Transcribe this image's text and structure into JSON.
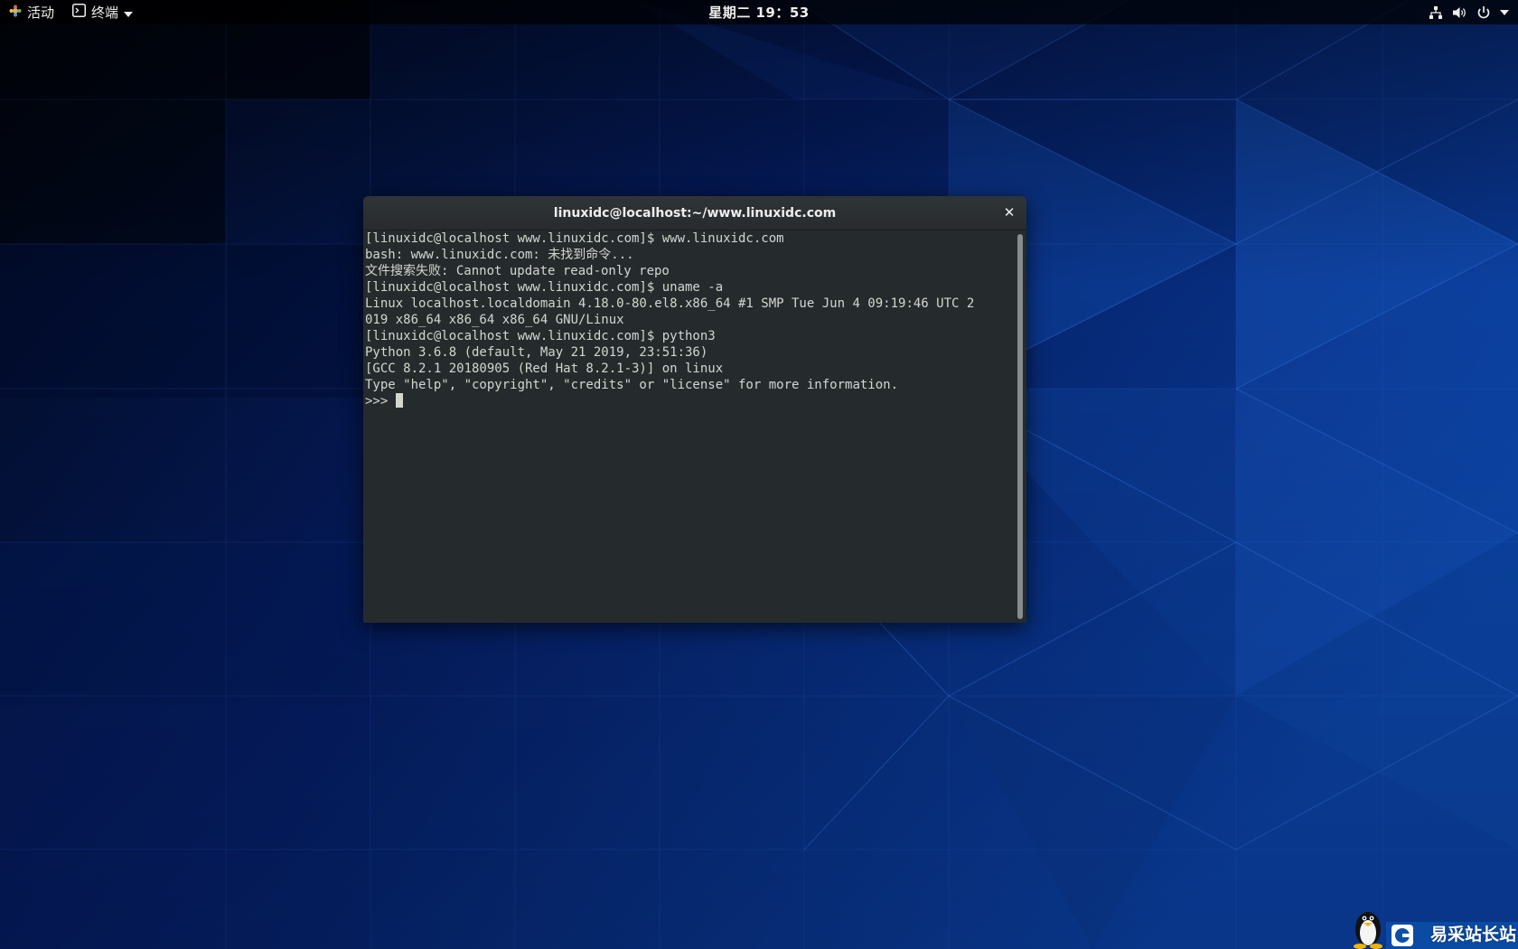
{
  "topbar": {
    "activities_label": "活动",
    "app_menu_label": "终端",
    "clock": "星期二 19：53",
    "icons": [
      "network-icon",
      "volume-icon",
      "power-icon",
      "chevron-down-icon"
    ]
  },
  "terminal": {
    "title": "linuxidc@localhost:~/www.linuxidc.com",
    "close_glyph": "✕",
    "lines": [
      "[linuxidc@localhost www.linuxidc.com]$ www.linuxidc.com",
      "bash: www.linuxidc.com: 未找到命令...",
      "文件搜索失败: Cannot update read-only repo",
      "[linuxidc@localhost www.linuxidc.com]$ uname -a",
      "Linux localhost.localdomain 4.18.0-80.el8.x86_64 #1 SMP Tue Jun 4 09:19:46 UTC 2",
      "019 x86_64 x86_64 x86_64 GNU/Linux",
      "[linuxidc@localhost www.linuxidc.com]$ python3",
      "Python 3.6.8 (default, May 21 2019, 23:51:36)",
      "[GCC 8.2.1 20180905 (Red Hat 8.2.1-3)] on linux",
      "Type \"help\", \"copyright\", \"credits\" or \"license\" for more information."
    ],
    "prompt": ">>> "
  },
  "watermark": {
    "text": "易采站长站"
  },
  "colors": {
    "terminal_bg": "#252a2c",
    "terminal_fg": "#d3d7cf",
    "titlebar_bg": "#2e3436",
    "topbar_bg": "#000000"
  }
}
